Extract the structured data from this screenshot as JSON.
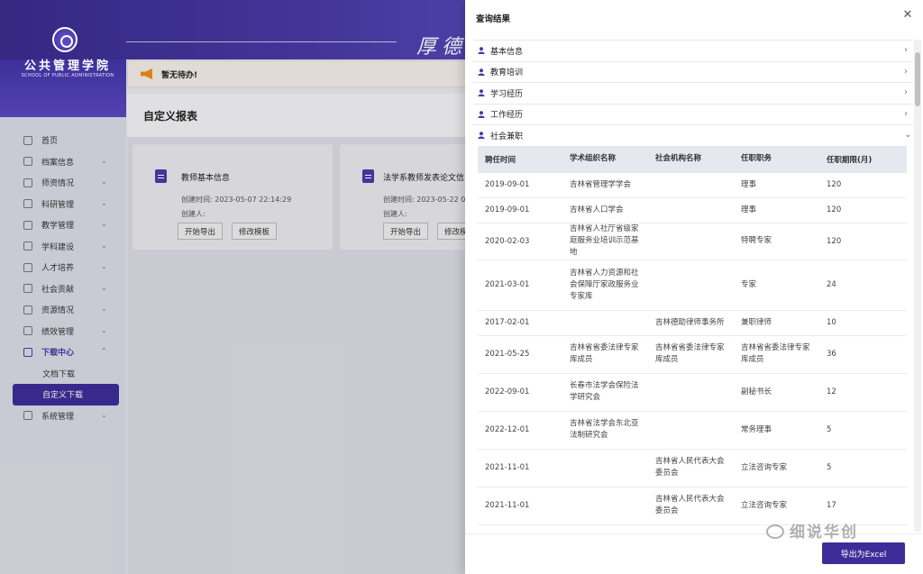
{
  "header": {
    "motto": "厚德"
  },
  "logo": {
    "name": "公共管理学院",
    "en": "SCHOOL OF PUBLIC ADMINISTRATION"
  },
  "sidebar": {
    "items": [
      {
        "label": "首页",
        "expandable": false
      },
      {
        "label": "档案信息",
        "expandable": true
      },
      {
        "label": "师资情况",
        "expandable": true
      },
      {
        "label": "科研管理",
        "expandable": true
      },
      {
        "label": "教学管理",
        "expandable": true
      },
      {
        "label": "学科建设",
        "expandable": true
      },
      {
        "label": "人才培养",
        "expandable": true
      },
      {
        "label": "社会贡献",
        "expandable": true
      },
      {
        "label": "资源情况",
        "expandable": true
      },
      {
        "label": "绩效管理",
        "expandable": true
      },
      {
        "label": "下载中心",
        "expandable": true,
        "open": true
      },
      {
        "label": "系统管理",
        "expandable": true
      }
    ],
    "download_sub": [
      "文档下载",
      "自定义下载"
    ]
  },
  "notice": {
    "text": "暂无待办!"
  },
  "report": {
    "title": "自定义报表",
    "cards": [
      {
        "title": "教师基本信息",
        "created_time": "创建时间: 2023-05-07 22:14:29",
        "creator": "创建人:",
        "btn_export": "开始导出",
        "btn_edit": "修改模板"
      },
      {
        "title": "法学系教师发表论文信",
        "created_time": "创建时间: 2023-05-22 0",
        "creator": "创建人:",
        "btn_export": "开始导出",
        "btn_edit": "修改模"
      }
    ]
  },
  "drawer": {
    "title": "查询结果",
    "sections": [
      "基本信息",
      "教育培训",
      "学习经历",
      "工作经历",
      "社会兼职"
    ],
    "table": {
      "headers": [
        "聘任时间",
        "学术组织名称",
        "社会机构名称",
        "任职职务",
        "任职期限(月)"
      ],
      "rows": [
        [
          "2019-09-01",
          "吉林省管理学学会",
          "",
          "理事",
          "120"
        ],
        [
          "2019-09-01",
          "吉林省人口学会",
          "",
          "理事",
          "120"
        ],
        [
          "2020-02-03",
          "吉林省人社厅省级家庭服务业培训示范基地",
          "",
          "特聘专家",
          "120"
        ],
        [
          "2021-03-01",
          "吉林省人力资源和社会保障厅家政服务业专家库",
          "",
          "专家",
          "24"
        ],
        [
          "2017-02-01",
          "",
          "吉林德助律师事务所",
          "兼职律师",
          "10"
        ],
        [
          "2021-05-25",
          "吉林省省委法律专家库成员",
          "吉林省省委法律专家库成员",
          "吉林省省委法律专家库成员",
          "36"
        ],
        [
          "2022-09-01",
          "长春市法学会保险法学研究会",
          "",
          "副秘书长",
          "12"
        ],
        [
          "2022-12-01",
          "吉林省法学会东北亚法制研究会",
          "",
          "常务理事",
          "5"
        ],
        [
          "2021-11-01",
          "",
          "吉林省人民代表大会委员会",
          "立法咨询专家",
          "5"
        ],
        [
          "2021-11-01",
          "",
          "吉林省人民代表大会委员会",
          "立法咨询专家",
          "17"
        ]
      ]
    },
    "export_label": "导出为Excel"
  },
  "watermark": "细说华创",
  "colors": {
    "primary": "#3e2d98",
    "header_gradient": "#4b3aa6",
    "notice_icon": "#f08a1a"
  }
}
